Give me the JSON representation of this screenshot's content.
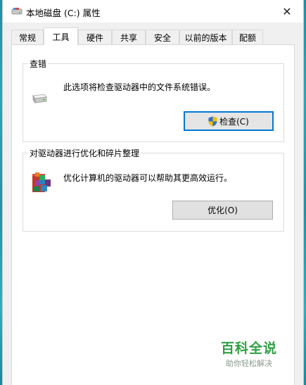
{
  "window": {
    "title": "本地磁盘 (C:) 属性",
    "close_symbol": "✕"
  },
  "tabs": [
    {
      "label": "常规",
      "active": false
    },
    {
      "label": "工具",
      "active": true
    },
    {
      "label": "硬件",
      "active": false
    },
    {
      "label": "共享",
      "active": false
    },
    {
      "label": "安全",
      "active": false
    },
    {
      "label": "以前的版本",
      "active": false
    },
    {
      "label": "配额",
      "active": false
    }
  ],
  "error_check": {
    "title": "查错",
    "description": "此选项将检查驱动器中的文件系统错误。",
    "button_label": "检查(C)",
    "icon": "drive-icon",
    "button_icon": "uac-shield-icon"
  },
  "optimize": {
    "title": "对驱动器进行优化和碎片整理",
    "description": "优化计算机的驱动器可以帮助其更高效运行。",
    "button_label": "优化(O)",
    "icon": "defrag-icon"
  },
  "watermark": {
    "main": "百科全说",
    "sub": "助你轻松解决"
  }
}
